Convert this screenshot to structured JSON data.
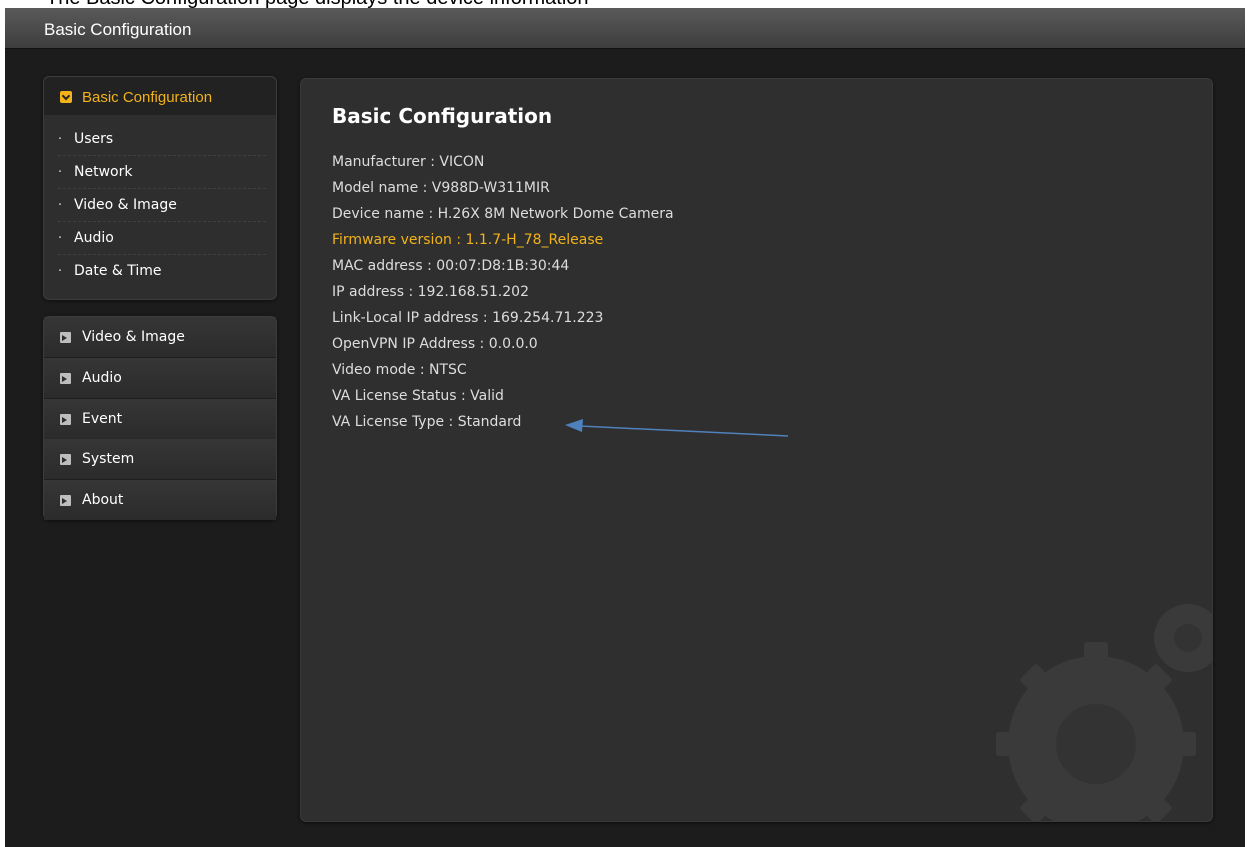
{
  "caption": "The Basic Configuration page displays the device information",
  "window": {
    "title": "Basic Configuration"
  },
  "sidebar": {
    "expanded_section": {
      "label": "Basic Configuration",
      "items": [
        {
          "label": "Users"
        },
        {
          "label": "Network"
        },
        {
          "label": "Video & Image"
        },
        {
          "label": "Audio"
        },
        {
          "label": "Date & Time"
        }
      ]
    },
    "sections": [
      {
        "label": "Video & Image"
      },
      {
        "label": "Audio"
      },
      {
        "label": "Event"
      },
      {
        "label": "System"
      },
      {
        "label": "About"
      }
    ]
  },
  "main": {
    "title": "Basic Configuration",
    "info": [
      "Manufacturer : VICON",
      "Model name : V988D-W311MIR",
      "Device name : H.26X 8M Network Dome Camera",
      "Firmware version : 1.1.7-H_78_Release",
      "MAC address : 00:07:D8:1B:30:44",
      "IP address : 192.168.51.202",
      "Link-Local IP address : 169.254.71.223",
      "OpenVPN IP Address : 0.0.0.0",
      "Video mode : NTSC",
      "VA License Status : Valid",
      "VA License Type : Standard"
    ]
  },
  "colors": {
    "accent": "#f2b21a",
    "background": "#1c1c1c",
    "panel": "#2f2f2f",
    "annotation_arrow": "#4f81bd"
  },
  "icons": {
    "section_toggle": "chevron-down-icon",
    "section_expand": "arrow-right-icon",
    "sub_bullet": "bullet-icon"
  }
}
